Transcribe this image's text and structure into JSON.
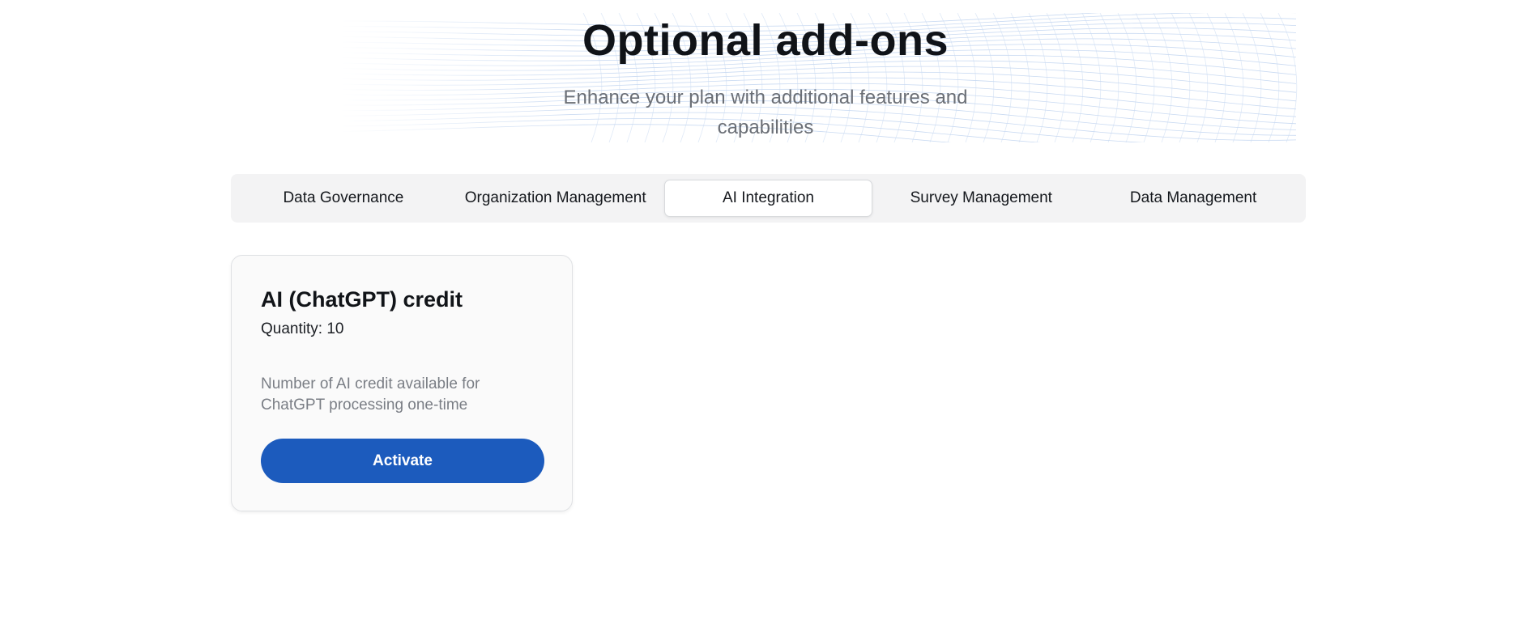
{
  "header": {
    "title": "Optional add-ons",
    "subtitle": "Enhance your plan with additional features and capabilities"
  },
  "tabs": [
    {
      "label": "Data Governance",
      "active": false
    },
    {
      "label": "Organization Management",
      "active": false
    },
    {
      "label": "AI Integration",
      "active": true
    },
    {
      "label": "Survey Management",
      "active": false
    },
    {
      "label": "Data Management",
      "active": false
    }
  ],
  "addon_card": {
    "title": "AI (ChatGPT) credit",
    "quantity": "Quantity: 10",
    "description": "Number of AI credit available for ChatGPT processing one-time",
    "button_label": "Activate"
  },
  "colors": {
    "accent": "#1c5bbd",
    "tab_bar_bg": "#f3f3f4",
    "wave_lines": "#c9daf2"
  }
}
